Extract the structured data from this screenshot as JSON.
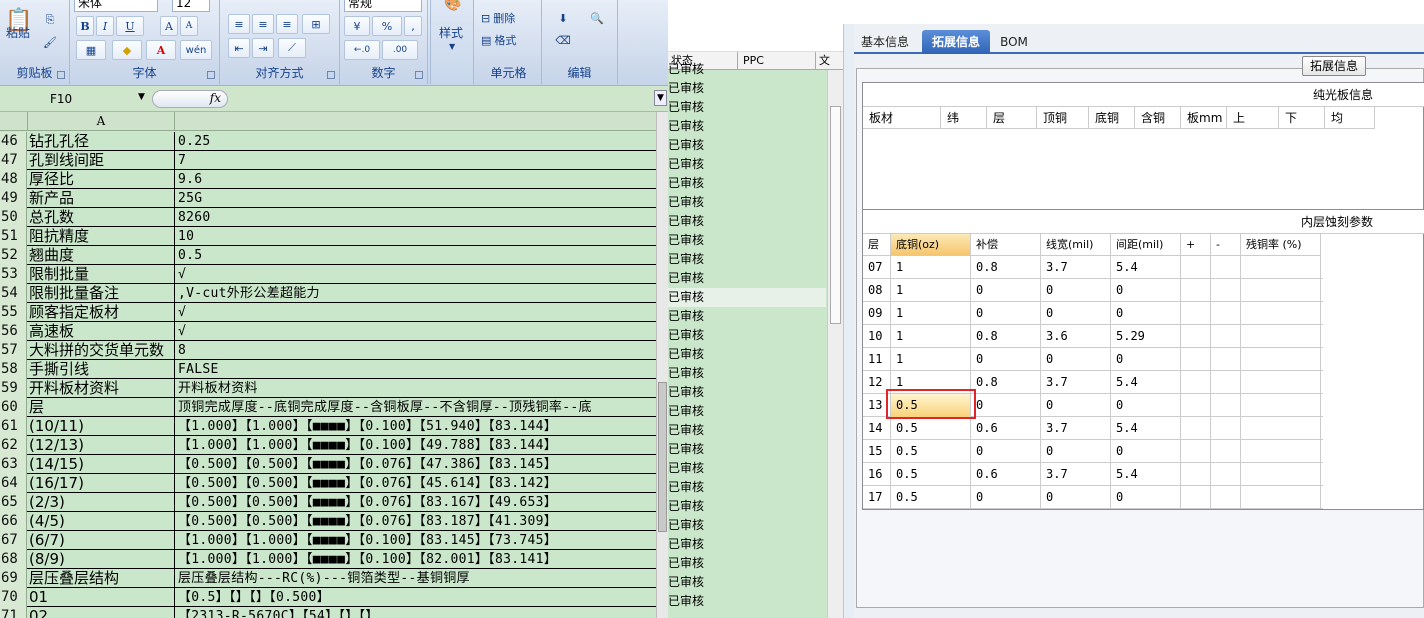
{
  "ribbon": {
    "clipboard": {
      "paste_label": "粘贴",
      "group_label": "剪贴板"
    },
    "font": {
      "font_name": "宋体",
      "font_size": "12",
      "group_label": "字体",
      "bold": "B",
      "italic": "I",
      "underline": "U",
      "grow": "A",
      "shrink": "A",
      "color_letter": "A",
      "wen": "wén"
    },
    "alignment": {
      "group_label": "对齐方式"
    },
    "number": {
      "format": "常规",
      "percent": "%",
      "comma": ",",
      "inc_dec": "←.0",
      "dec_dec": ".00",
      "group_label": "数字"
    },
    "styles": {
      "label": "样式"
    },
    "cells": {
      "delete_label": "删除",
      "format_label": "格式",
      "group_label": "单元格"
    },
    "editing": {
      "group_label": "编辑"
    }
  },
  "formula_bar": {
    "name_box": "F10",
    "fx": "fx",
    "value": ""
  },
  "sheet": {
    "col_a": "A",
    "rows": [
      {
        "n": "46",
        "a": "钻孔孔径",
        "b": "0.25"
      },
      {
        "n": "47",
        "a": "孔到线间距",
        "b": "7"
      },
      {
        "n": "48",
        "a": "厚径比",
        "b": "9.6"
      },
      {
        "n": "49",
        "a": "新产品",
        "b": "25G"
      },
      {
        "n": "50",
        "a": "总孔数",
        "b": "8260"
      },
      {
        "n": "51",
        "a": "阻抗精度",
        "b": "10"
      },
      {
        "n": "52",
        "a": "翘曲度",
        "b": "0.5"
      },
      {
        "n": "53",
        "a": "限制批量",
        "b": "√"
      },
      {
        "n": "54",
        "a": "限制批量备注",
        "b": ",V-cut外形公差超能力"
      },
      {
        "n": "55",
        "a": "顾客指定板材",
        "b": "√"
      },
      {
        "n": "56",
        "a": "高速板",
        "b": "√"
      },
      {
        "n": "57",
        "a": "大料拼的交货单元数",
        "b": "8"
      },
      {
        "n": "58",
        "a": "手撕引线",
        "b": "FALSE"
      },
      {
        "n": "59",
        "a": "开料板材资料",
        "b": "开料板材资料"
      },
      {
        "n": "60",
        "a": "层",
        "b": "顶铜完成厚度--底铜完成厚度--含铜板厚--不含铜厚--顶残铜率--底"
      },
      {
        "n": "61",
        "a": "(10/11)",
        "b": "【1.000】【1.000】【■■■■】【0.100】【51.940】【83.144】"
      },
      {
        "n": "62",
        "a": "(12/13)",
        "b": "【1.000】【1.000】【■■■■】【0.100】【49.788】【83.144】"
      },
      {
        "n": "63",
        "a": "(14/15)",
        "b": "【0.500】【0.500】【■■■■】【0.076】【47.386】【83.145】"
      },
      {
        "n": "64",
        "a": "(16/17)",
        "b": "【0.500】【0.500】【■■■■】【0.076】【45.614】【83.142】"
      },
      {
        "n": "65",
        "a": "(2/3)",
        "b": "【0.500】【0.500】【■■■■】【0.076】【83.167】【49.653】"
      },
      {
        "n": "66",
        "a": "(4/5)",
        "b": "【0.500】【0.500】【■■■■】【0.076】【83.187】【41.309】"
      },
      {
        "n": "67",
        "a": "(6/7)",
        "b": "【1.000】【1.000】【■■■■】【0.100】【83.145】【73.745】"
      },
      {
        "n": "68",
        "a": "(8/9)",
        "b": "【1.000】【1.000】【■■■■】【0.100】【82.001】【83.141】"
      },
      {
        "n": "69",
        "a": "层压叠层结构",
        "b": "层压叠层结构---RC(%)---铜箔类型--基铜铜厚"
      },
      {
        "n": "70",
        "a": "01",
        "b": "【0.5】【】【】【0.500】"
      },
      {
        "n": "71",
        "a": "02",
        "b": "【2313-R-5670C】【54】【】【】"
      }
    ]
  },
  "midlist": {
    "col_status": "状态",
    "col_ppc": "PPC",
    "col_more": "文",
    "item_label": "已审核"
  },
  "right": {
    "tabs": [
      "基本信息",
      "拓展信息",
      "BOM"
    ],
    "active_tab": 1,
    "ext_button": "拓展信息",
    "grid1": {
      "title": "纯光板信息",
      "headers": [
        "板材",
        "纬",
        "层",
        "顶铜",
        "底铜",
        "含铜",
        "板mm",
        "上",
        "下",
        "均"
      ]
    },
    "grid2": {
      "title": "内层蚀刻参数",
      "headers": [
        "层",
        "底铜(oz)",
        "补偿",
        "线宽(mil)",
        "间距(mil)",
        "+",
        "-",
        "残铜率 (%)"
      ],
      "rows": [
        [
          "07",
          "1",
          "0.8",
          "3.7",
          "5.4"
        ],
        [
          "08",
          "1",
          "0",
          "0",
          "0"
        ],
        [
          "09",
          "1",
          "0",
          "0",
          "0"
        ],
        [
          "10",
          "1",
          "0.8",
          "3.6",
          "5.29"
        ],
        [
          "11",
          "1",
          "0",
          "0",
          "0"
        ],
        [
          "12",
          "1",
          "0.8",
          "3.7",
          "5.4"
        ],
        [
          "13",
          "0.5",
          "0",
          "0",
          "0"
        ],
        [
          "14",
          "0.5",
          "0.6",
          "3.7",
          "5.4"
        ],
        [
          "15",
          "0.5",
          "0",
          "0",
          "0"
        ],
        [
          "16",
          "0.5",
          "0.6",
          "3.7",
          "5.4"
        ],
        [
          "17",
          "0.5",
          "0",
          "0",
          "0"
        ]
      ]
    }
  }
}
